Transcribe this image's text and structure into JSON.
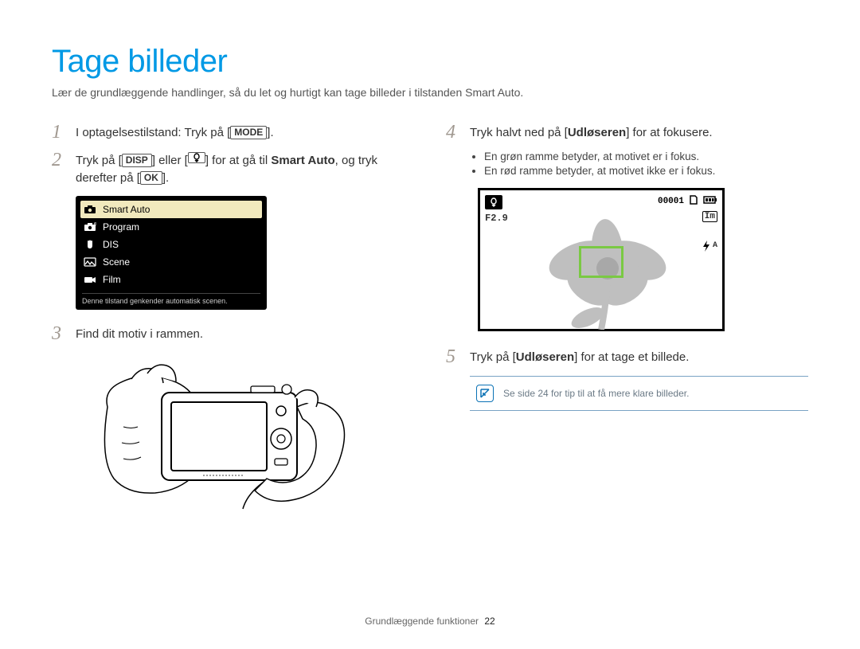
{
  "title": "Tage billeder",
  "subtitle": "Lær de grundlæggende handlinger, så du let og hurtigt kan tage billeder i tilstanden Smart Auto.",
  "steps": {
    "s1": {
      "num": "1",
      "pre": "I optagelsestilstand: Tryk på [",
      "btn": "MODE",
      "post": "]."
    },
    "s2": {
      "num": "2",
      "a": "Tryk på [",
      "btn_disp": "DISP",
      "b": "] eller [",
      "c": "] for at gå til ",
      "smart": "Smart Auto",
      "d": ", og tryk derefter på [",
      "btn_ok": "OK",
      "e": "]."
    },
    "s3": {
      "num": "3",
      "text": "Find dit motiv i rammen."
    },
    "s4": {
      "num": "4",
      "a": "Tryk halvt ned på [",
      "shutter": "Udløseren",
      "b": "] for at fokusere.",
      "bullet1": "En grøn ramme betyder, at motivet er i fokus.",
      "bullet2": "En rød ramme betyder, at motivet ikke er i fokus."
    },
    "s5": {
      "num": "5",
      "a": "Tryk på [",
      "shutter": "Udløseren",
      "b": "] for at tage et billede."
    }
  },
  "mode_menu": {
    "items": [
      {
        "label": "Smart Auto",
        "selected": true
      },
      {
        "label": "Program",
        "selected": false
      },
      {
        "label": "DIS",
        "selected": false
      },
      {
        "label": "Scene",
        "selected": false
      },
      {
        "label": "Film",
        "selected": false
      }
    ],
    "caption": "Denne tilstand genkender automatisk scenen."
  },
  "lcd": {
    "counter": "00001",
    "aperture": "F2.9",
    "size": "Im",
    "flash_label": "A"
  },
  "note": {
    "text": "Se side 24 for tip til at få mere klare billeder."
  },
  "footer": {
    "section": "Grundlæggende funktioner",
    "page": "22"
  }
}
